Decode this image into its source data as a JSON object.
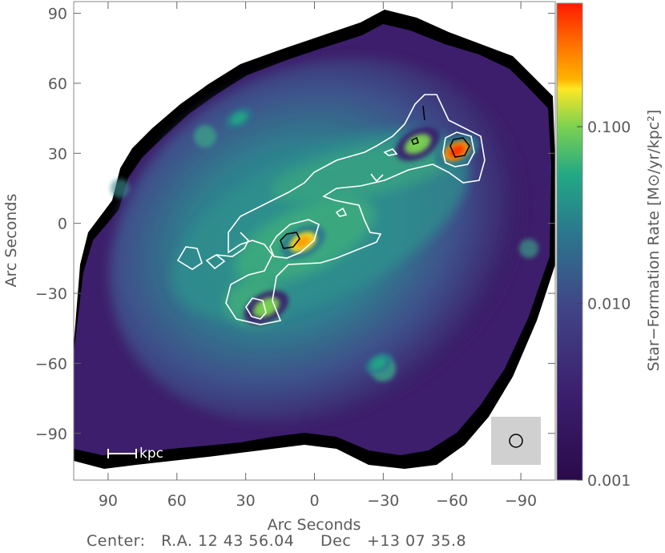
{
  "chart_data": {
    "type": "heatmap",
    "xlabel": "Arc Seconds",
    "ylabel": "Arc Seconds",
    "colorbar_label": "Star−Formation Rate [M⊙/yr/kpc²]",
    "x_ticks": [
      "90",
      "60",
      "30",
      "0",
      "−30",
      "−60",
      "−90"
    ],
    "x_tick_values": [
      90,
      60,
      30,
      0,
      -30,
      -60,
      -90
    ],
    "y_ticks": [
      "90",
      "60",
      "30",
      "0",
      "−30",
      "−60",
      "−90"
    ],
    "y_tick_values": [
      90,
      60,
      30,
      0,
      -30,
      -60,
      -90
    ],
    "xlim": [
      105,
      -105
    ],
    "ylim": [
      -110,
      95
    ],
    "colorbar_ticks": [
      "0.100",
      "0.010",
      "0.001"
    ],
    "colorbar_tick_values": [
      0.1,
      0.01,
      0.001
    ],
    "colorbar_range": [
      0.001,
      0.5
    ],
    "colorbar_scale": "log",
    "colormap": [
      "#2a0a4a",
      "#3b1f6e",
      "#414487",
      "#2a788e",
      "#22a884",
      "#7ad151",
      "#fde725",
      "#ff9800",
      "#ff2a00"
    ],
    "blobs": [
      {
        "x": 5,
        "y": -8,
        "sfr": 0.22
      },
      {
        "x": -62,
        "y": 31,
        "sfr": 0.35
      },
      {
        "x": 21,
        "y": -36,
        "sfr": 0.07
      },
      {
        "x": -45,
        "y": 34,
        "sfr": 0.06
      },
      {
        "x": 33,
        "y": 45,
        "sfr": 0.02
      },
      {
        "x": -28,
        "y": -60,
        "sfr": 0.02
      }
    ],
    "scale_bar_label": "kpc",
    "beam_marker": "beam-circle"
  },
  "footer": {
    "center_label": "Center:",
    "ra_label": "R.A.",
    "ra_value": "12 43 56.04",
    "dec_label": "Dec",
    "dec_value": "+13 07 35.8"
  }
}
